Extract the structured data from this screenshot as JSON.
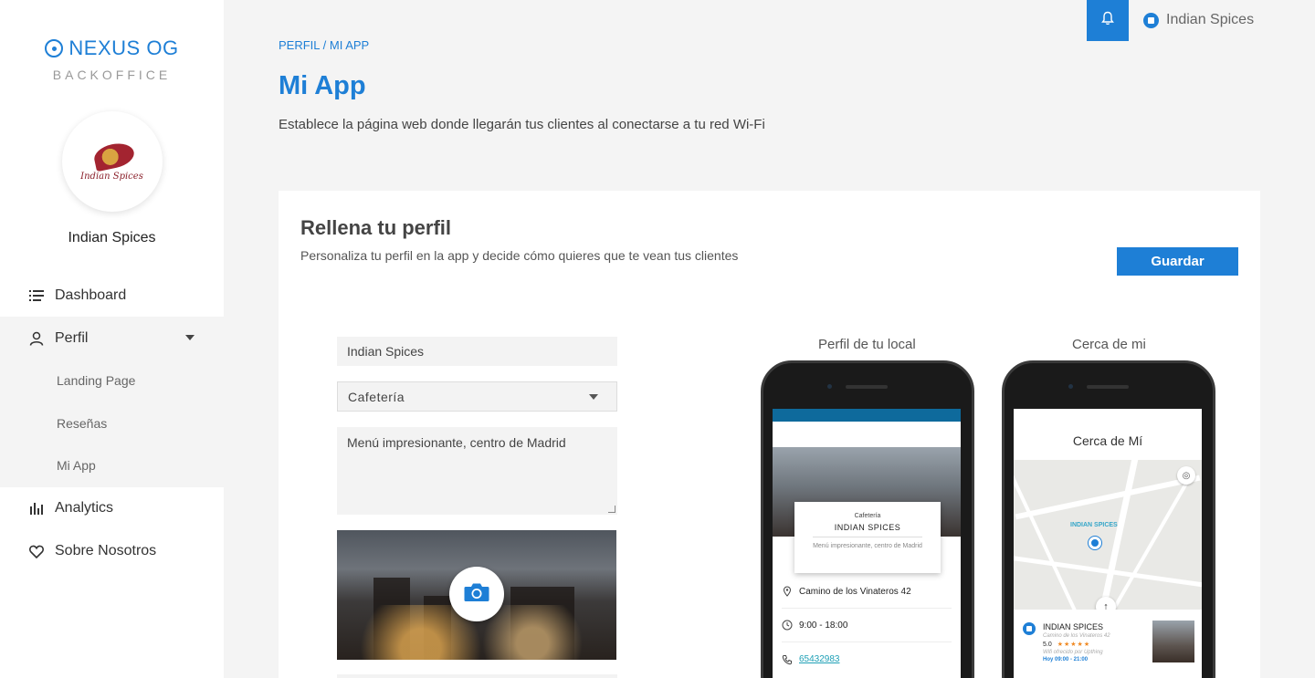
{
  "brand": {
    "name": "NEXUS OG",
    "sub": "BACKOFFICE"
  },
  "venue": {
    "name": "Indian Spices",
    "logo_text": "Indian Spices"
  },
  "sidebar": {
    "items": [
      {
        "label": "Dashboard",
        "icon": "list-icon"
      },
      {
        "label": "Perfil",
        "icon": "user-icon"
      },
      {
        "label": "Analytics",
        "icon": "bar-chart-icon"
      },
      {
        "label": "Sobre Nosotros",
        "icon": "heart-icon"
      }
    ],
    "sub_items": [
      {
        "label": "Landing Page"
      },
      {
        "label": "Reseñas"
      },
      {
        "label": "Mi App"
      }
    ]
  },
  "topbar": {
    "user_name": "Indian Spices",
    "bell_icon": "bell-icon"
  },
  "header": {
    "breadcrumb": "PERFIL / MI APP",
    "title": "Mi App",
    "description": "Establece la página web donde llegarán tus clientes al conectarse a tu red Wi-Fi"
  },
  "card": {
    "title": "Rellena tu perfil",
    "description": "Personaliza tu perfil en la app y decide cómo quieres que te vean tus clientes",
    "save_label": "Guardar"
  },
  "form": {
    "name_value": "Indian Spices",
    "category_value": "Cafetería",
    "description_value": "Menú impresionante, centro de Madrid",
    "camera_icon": "camera-icon"
  },
  "preview": {
    "profile_label": "Perfil de tu local",
    "nearby_label": "Cerca de mi",
    "profile": {
      "category": "Cafetería",
      "name": "INDIAN SPICES",
      "description": "Menú impresionante, centro de Madrid",
      "address": "Camino de los Vinateros 42",
      "hours": "9:00 - 18:00",
      "phone": "65432983"
    },
    "nearby": {
      "title": "Cerca de Mí",
      "map_label": "INDIAN SPICES",
      "item_name": "INDIAN SPICES",
      "item_address": "Camino de los Vinateros 42",
      "rating": "5.0",
      "stars": "★★★★★",
      "wifi": "Wifi ofrecido por Upthing",
      "hours": "Hoy 09:00 - 21:00"
    }
  },
  "colors": {
    "accent": "#1e7fd6",
    "bar": "#0e6a9c",
    "stars": "#f08a24"
  }
}
